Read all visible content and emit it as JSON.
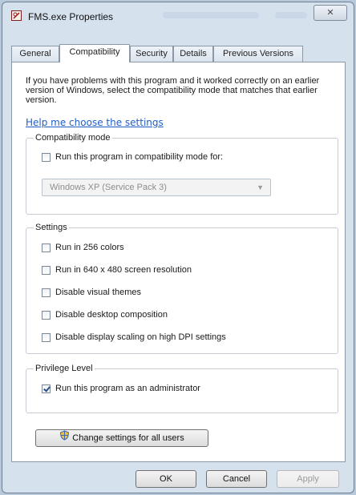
{
  "window": {
    "title": "FMS.exe Properties",
    "close_glyph": "✕",
    "icon": "application-icon"
  },
  "tabs": [
    {
      "label": "General"
    },
    {
      "label": "Compatibility"
    },
    {
      "label": "Security"
    },
    {
      "label": "Details"
    },
    {
      "label": "Previous Versions"
    }
  ],
  "intro": {
    "text": "If you have problems with this program and it worked correctly on an earlier version of Windows, select the compatibility mode that matches that earlier version.",
    "help_link": "Help me choose the settings"
  },
  "compat_mode": {
    "label": "Compatibility mode",
    "run_in_mode_label": "Run this program in compatibility mode for:",
    "run_in_mode_checked": false,
    "selected_os": "Windows XP (Service Pack 3)"
  },
  "settings": {
    "label": "Settings",
    "items": [
      {
        "label": "Run in 256 colors",
        "checked": false
      },
      {
        "label": "Run in 640 x 480 screen resolution",
        "checked": false
      },
      {
        "label": "Disable visual themes",
        "checked": false
      },
      {
        "label": "Disable desktop composition",
        "checked": false
      },
      {
        "label": "Disable display scaling on high DPI settings",
        "checked": false
      }
    ]
  },
  "privilege": {
    "label": "Privilege Level",
    "admin_label": "Run this program as an administrator",
    "admin_checked": true
  },
  "change_all_users": {
    "label": "Change settings for all users",
    "icon": "uac-shield-icon"
  },
  "footer": {
    "ok": "OK",
    "cancel": "Cancel",
    "apply": "Apply"
  }
}
